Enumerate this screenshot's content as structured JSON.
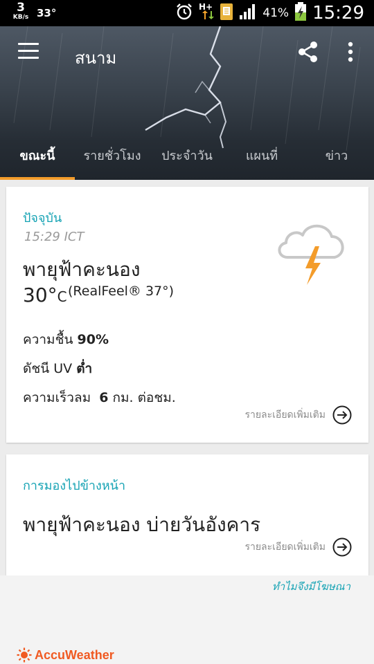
{
  "status_bar": {
    "net_speed": "3",
    "net_speed_unit": "KB/s",
    "temp": "33°",
    "network": "H+",
    "battery_pct": "41%",
    "clock": "15:29",
    "icons": [
      "alarm-icon",
      "data-arrows-icon",
      "sim-icon",
      "signal-icon",
      "battery-charging-icon"
    ]
  },
  "header": {
    "title": "สนาม",
    "icons": [
      "menu-icon",
      "share-icon",
      "more-vert-icon"
    ]
  },
  "tabs": [
    {
      "label": "ขณะนี้",
      "active": true
    },
    {
      "label": "รายชั่วโมง",
      "active": false
    },
    {
      "label": "ประจำวัน",
      "active": false
    },
    {
      "label": "แผนที่",
      "active": false
    },
    {
      "label": "ข่าว",
      "active": false
    }
  ],
  "current": {
    "label": "ปัจจุบัน",
    "time": "15:29 ICT",
    "condition": "พายุฟ้าคะนอง",
    "temp_value": "30°",
    "temp_unit": "C",
    "realfeel": "(RealFeel® 37°)",
    "humidity_label": "ความชื้น",
    "humidity_value": "90%",
    "uv_label": "ดัชนี UV",
    "uv_value": "ต่ำ",
    "wind_label": "ความเร็วลม",
    "wind_value": "6",
    "wind_unit": "กม. ต่อชม.",
    "more_details": "รายละเอียดเพิ่มเติม",
    "icon": "thunderstorm-icon"
  },
  "outlook": {
    "label": "การมองไปข้างหน้า",
    "text": "พายุฟ้าคะนอง บ่ายวันอังคาร",
    "more_details": "รายละเอียดเพิ่มเติม"
  },
  "ad": {
    "why_ads": "ทำไมจึงมีโฆษณา",
    "brand": "AccuWeather"
  },
  "colors": {
    "accent_teal": "#16a3b4",
    "tab_indicator": "#f39c2b",
    "brand_orange": "#f05a22"
  }
}
